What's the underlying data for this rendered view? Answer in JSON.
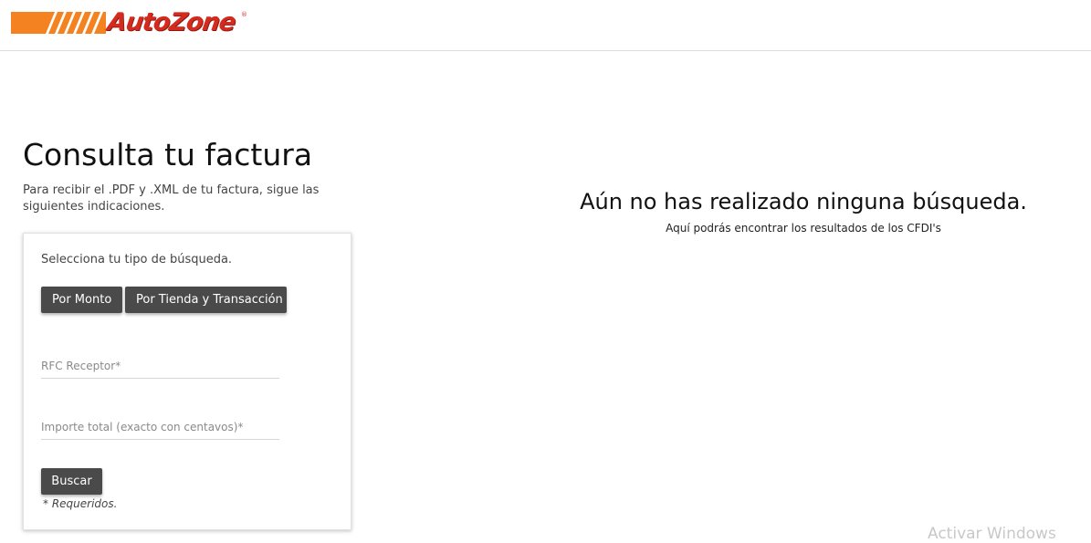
{
  "brand": {
    "name": "AutoZone",
    "trademark": "®",
    "colors": {
      "orange": "#f58220",
      "red": "#d52b1e"
    }
  },
  "page": {
    "title": "Consulta tu factura",
    "subtitle": "Para recibir el .PDF y .XML de tu factura, sigue las siguientes indicaciones."
  },
  "search_card": {
    "instruction": "Selecciona tu tipo de búsqueda.",
    "search_types": [
      "Por Monto",
      "Por Tienda y Transacción"
    ],
    "fields": {
      "rfc_placeholder": "RFC Receptor*",
      "rfc_value": "",
      "importe_placeholder": "Importe total (exacto con centavos)*",
      "importe_value": ""
    },
    "submit_label": "Buscar",
    "required_note": "* Requeridos."
  },
  "results": {
    "empty_title": "Aún no has realizado ninguna búsqueda.",
    "empty_subtitle": "Aquí podrás encontrar los resultados de los CFDI's"
  },
  "os_watermark": "Activar Windows",
  "accent_colors": {
    "button_bg": "#4a4a4a",
    "button_text": "#ffffff"
  }
}
